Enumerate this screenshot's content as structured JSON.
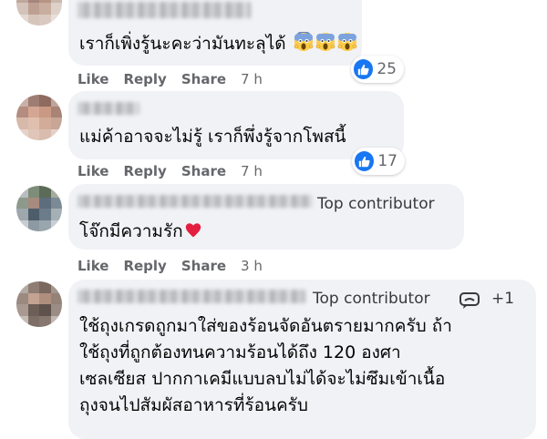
{
  "comments": [
    {
      "lines": [
        "เราก็เพิ่งรู้นะคะว่ามันทะลุได้"
      ],
      "emoji": [
        "face-screaming-in-fear-icon",
        "face-screaming-in-fear-icon",
        "face-screaming-in-fear-icon"
      ],
      "actions": {
        "like": "Like",
        "reply": "Reply",
        "share": "Share",
        "time": "7 h"
      },
      "reaction_count": "25"
    },
    {
      "lines": [
        "แม่ค้าอาจจะไม่รู้ เราก็พึ่งรู้จากโพสนี้"
      ],
      "actions": {
        "like": "Like",
        "reply": "Reply",
        "share": "Share",
        "time": "7 h"
      },
      "reaction_count": "17"
    },
    {
      "badge": "Top contributor",
      "lines": [
        "โจ๊กมีความรัก"
      ],
      "emoji": [
        "red-heart-icon"
      ],
      "actions": {
        "like": "Like",
        "reply": "Reply",
        "share": "Share",
        "time": "3 h"
      }
    },
    {
      "badge": "Top contributor",
      "badge_extra": "+1",
      "lines": [
        "ใช้ถุงเกรดถูกมาใส่ของร้อนจัดอันตรายมากครับ ถ้า",
        "ใช้ถุงที่ถูกต้องทนความร้อนได้ถึง 120 องศา",
        "เซลเซียส ปากกาเคมีแบบลบไม่ได้จะไม่ซึมเข้าเนื้อ",
        "ถุงจนไปสัมผัสอาหารที่ร้อนครับ"
      ]
    }
  ],
  "colors": {
    "bubble": "#f0f2f5",
    "action_text": "#65676b",
    "like_blue": "#1877f2",
    "heart_red": "#e41e3f"
  }
}
